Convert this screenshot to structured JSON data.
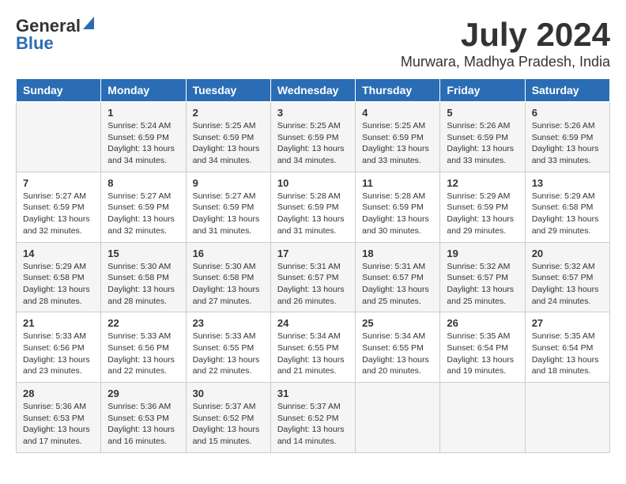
{
  "logo": {
    "general": "General",
    "blue": "Blue"
  },
  "title": {
    "month_year": "July 2024",
    "location": "Murwara, Madhya Pradesh, India"
  },
  "headers": [
    "Sunday",
    "Monday",
    "Tuesday",
    "Wednesday",
    "Thursday",
    "Friday",
    "Saturday"
  ],
  "weeks": [
    [
      {
        "day": "",
        "content": ""
      },
      {
        "day": "1",
        "content": "Sunrise: 5:24 AM\nSunset: 6:59 PM\nDaylight: 13 hours\nand 34 minutes."
      },
      {
        "day": "2",
        "content": "Sunrise: 5:25 AM\nSunset: 6:59 PM\nDaylight: 13 hours\nand 34 minutes."
      },
      {
        "day": "3",
        "content": "Sunrise: 5:25 AM\nSunset: 6:59 PM\nDaylight: 13 hours\nand 34 minutes."
      },
      {
        "day": "4",
        "content": "Sunrise: 5:25 AM\nSunset: 6:59 PM\nDaylight: 13 hours\nand 33 minutes."
      },
      {
        "day": "5",
        "content": "Sunrise: 5:26 AM\nSunset: 6:59 PM\nDaylight: 13 hours\nand 33 minutes."
      },
      {
        "day": "6",
        "content": "Sunrise: 5:26 AM\nSunset: 6:59 PM\nDaylight: 13 hours\nand 33 minutes."
      }
    ],
    [
      {
        "day": "7",
        "content": "Sunrise: 5:27 AM\nSunset: 6:59 PM\nDaylight: 13 hours\nand 32 minutes."
      },
      {
        "day": "8",
        "content": "Sunrise: 5:27 AM\nSunset: 6:59 PM\nDaylight: 13 hours\nand 32 minutes."
      },
      {
        "day": "9",
        "content": "Sunrise: 5:27 AM\nSunset: 6:59 PM\nDaylight: 13 hours\nand 31 minutes."
      },
      {
        "day": "10",
        "content": "Sunrise: 5:28 AM\nSunset: 6:59 PM\nDaylight: 13 hours\nand 31 minutes."
      },
      {
        "day": "11",
        "content": "Sunrise: 5:28 AM\nSunset: 6:59 PM\nDaylight: 13 hours\nand 30 minutes."
      },
      {
        "day": "12",
        "content": "Sunrise: 5:29 AM\nSunset: 6:59 PM\nDaylight: 13 hours\nand 29 minutes."
      },
      {
        "day": "13",
        "content": "Sunrise: 5:29 AM\nSunset: 6:58 PM\nDaylight: 13 hours\nand 29 minutes."
      }
    ],
    [
      {
        "day": "14",
        "content": "Sunrise: 5:29 AM\nSunset: 6:58 PM\nDaylight: 13 hours\nand 28 minutes."
      },
      {
        "day": "15",
        "content": "Sunrise: 5:30 AM\nSunset: 6:58 PM\nDaylight: 13 hours\nand 28 minutes."
      },
      {
        "day": "16",
        "content": "Sunrise: 5:30 AM\nSunset: 6:58 PM\nDaylight: 13 hours\nand 27 minutes."
      },
      {
        "day": "17",
        "content": "Sunrise: 5:31 AM\nSunset: 6:57 PM\nDaylight: 13 hours\nand 26 minutes."
      },
      {
        "day": "18",
        "content": "Sunrise: 5:31 AM\nSunset: 6:57 PM\nDaylight: 13 hours\nand 25 minutes."
      },
      {
        "day": "19",
        "content": "Sunrise: 5:32 AM\nSunset: 6:57 PM\nDaylight: 13 hours\nand 25 minutes."
      },
      {
        "day": "20",
        "content": "Sunrise: 5:32 AM\nSunset: 6:57 PM\nDaylight: 13 hours\nand 24 minutes."
      }
    ],
    [
      {
        "day": "21",
        "content": "Sunrise: 5:33 AM\nSunset: 6:56 PM\nDaylight: 13 hours\nand 23 minutes."
      },
      {
        "day": "22",
        "content": "Sunrise: 5:33 AM\nSunset: 6:56 PM\nDaylight: 13 hours\nand 22 minutes."
      },
      {
        "day": "23",
        "content": "Sunrise: 5:33 AM\nSunset: 6:55 PM\nDaylight: 13 hours\nand 22 minutes."
      },
      {
        "day": "24",
        "content": "Sunrise: 5:34 AM\nSunset: 6:55 PM\nDaylight: 13 hours\nand 21 minutes."
      },
      {
        "day": "25",
        "content": "Sunrise: 5:34 AM\nSunset: 6:55 PM\nDaylight: 13 hours\nand 20 minutes."
      },
      {
        "day": "26",
        "content": "Sunrise: 5:35 AM\nSunset: 6:54 PM\nDaylight: 13 hours\nand 19 minutes."
      },
      {
        "day": "27",
        "content": "Sunrise: 5:35 AM\nSunset: 6:54 PM\nDaylight: 13 hours\nand 18 minutes."
      }
    ],
    [
      {
        "day": "28",
        "content": "Sunrise: 5:36 AM\nSunset: 6:53 PM\nDaylight: 13 hours\nand 17 minutes."
      },
      {
        "day": "29",
        "content": "Sunrise: 5:36 AM\nSunset: 6:53 PM\nDaylight: 13 hours\nand 16 minutes."
      },
      {
        "day": "30",
        "content": "Sunrise: 5:37 AM\nSunset: 6:52 PM\nDaylight: 13 hours\nand 15 minutes."
      },
      {
        "day": "31",
        "content": "Sunrise: 5:37 AM\nSunset: 6:52 PM\nDaylight: 13 hours\nand 14 minutes."
      },
      {
        "day": "",
        "content": ""
      },
      {
        "day": "",
        "content": ""
      },
      {
        "day": "",
        "content": ""
      }
    ]
  ]
}
